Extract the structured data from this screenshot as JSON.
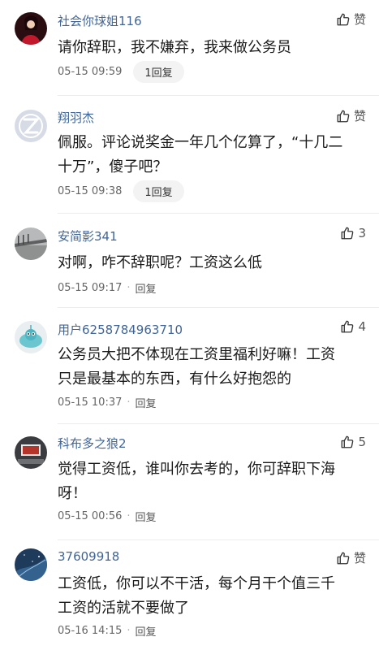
{
  "colors": {
    "username": "#406599",
    "text": "#1a1a1a",
    "meta": "#666666",
    "pill_bg": "#f3f3f3"
  },
  "comments": [
    {
      "user": "社会你球姐116",
      "like_label": "赞",
      "content": "请你辞职，我不嫌弃，我来做公务员",
      "time": "05-15 09:59",
      "reply": "1回复"
    },
    {
      "user": "翔羽杰",
      "like_label": "赞",
      "content": "佩服。评论说奖金一年几个亿算了，“十几二\n十万”，傻子吧？",
      "time": "05-15 09:38",
      "reply": "1回复"
    },
    {
      "user": "安简影341",
      "like_label": "3",
      "content": "对啊，咋不辞职呢？工资这么低",
      "time": "05-15 09:17",
      "reply": "回复"
    },
    {
      "user": "用户6258784963710",
      "like_label": "4",
      "content": "公务员大把不体现在工资里福利好嘛！工资\n只是最基本的东西，有什么好抱怨的",
      "time": "05-15 10:37",
      "reply": "回复"
    },
    {
      "user": "科布多之狼2",
      "like_label": "5",
      "content": "觉得工资低，谁叫你去考的，你可辞职下海\n呀！",
      "time": "05-15 00:56",
      "reply": "回复"
    },
    {
      "user": "37609918",
      "like_label": "赞",
      "content": "工资低，你可以不干活，每个月干个值三千\n工资的活就不要做了",
      "time": "05-16 14:15",
      "reply": "回复"
    }
  ]
}
